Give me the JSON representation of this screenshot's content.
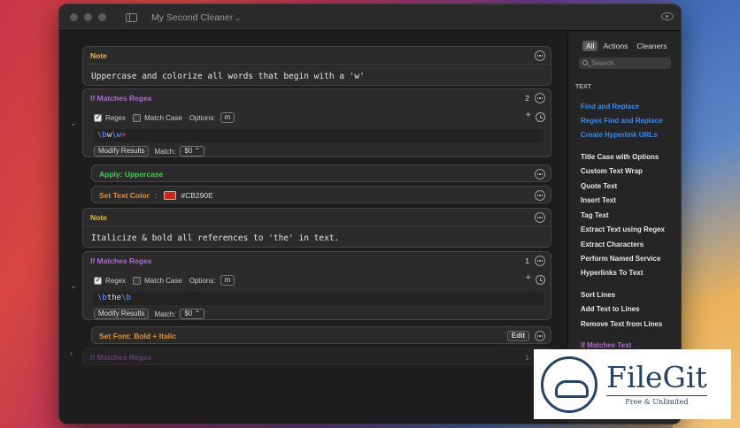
{
  "window": {
    "title": "My Second Cleaner"
  },
  "cards": {
    "note1": {
      "header": "Note",
      "text": "Uppercase and colorize all words that begin with a 'w'"
    },
    "match1": {
      "header": "If Matches Regex",
      "count": "2",
      "regex_label": "Regex",
      "matchcase_label": "Match Case",
      "options_label": "Options:",
      "options_value": "m",
      "pattern_a": "\\b",
      "pattern_b": "w",
      "pattern_c": "\\w",
      "pattern_d": "+",
      "modify_label": "Modify Results",
      "match_label": "Match:",
      "match_value": "$0"
    },
    "apply1": {
      "header": "Apply: Uppercase"
    },
    "color1": {
      "header": "Set Text Color",
      "colon": ":",
      "value": "#CB290E"
    },
    "note2": {
      "header": "Note",
      "text": "Italicize & bold all references to 'the' in text."
    },
    "match2": {
      "header": "If Matches Regex",
      "count": "1",
      "regex_label": "Regex",
      "matchcase_label": "Match Case",
      "options_label": "Options:",
      "options_value": "m",
      "pattern_a": "\\b",
      "pattern_b": "the",
      "pattern_c": "\\b",
      "modify_label": "Modify Results",
      "match_label": "Match:",
      "match_value": "$0"
    },
    "font1": {
      "header": "Set Font: Bold + Italic",
      "edit_label": "Edit"
    },
    "match3": {
      "header": "If Matches Regex",
      "count": "1"
    }
  },
  "panel": {
    "tabs": [
      "All",
      "Actions",
      "Cleaners"
    ],
    "search_placeholder": "Search",
    "section": "TEXT",
    "items": [
      "Find and Replace",
      "Regex Find and Replace",
      "Create Hyperlink URLs",
      "Title Case with Options",
      "Custom Text Wrap",
      "Quote Text",
      "Insert Text",
      "Tag Text",
      "Extract Text using Regex",
      "Extract Characters",
      "Perform Named Service",
      "Hyperlinks To Text",
      "Sort Lines",
      "Add Text to Lines",
      "Remove Text from Lines",
      "If Matches Text"
    ]
  },
  "watermark": {
    "title": "FileGit",
    "subtitle": "Free & Unlimited"
  },
  "colors": {
    "swatch": "#CB290E",
    "link": "#3B8BF0",
    "note": "#E9B93A",
    "regex": "#B06AD6",
    "apply": "#3FCF4A",
    "action": "#E98F2E"
  }
}
